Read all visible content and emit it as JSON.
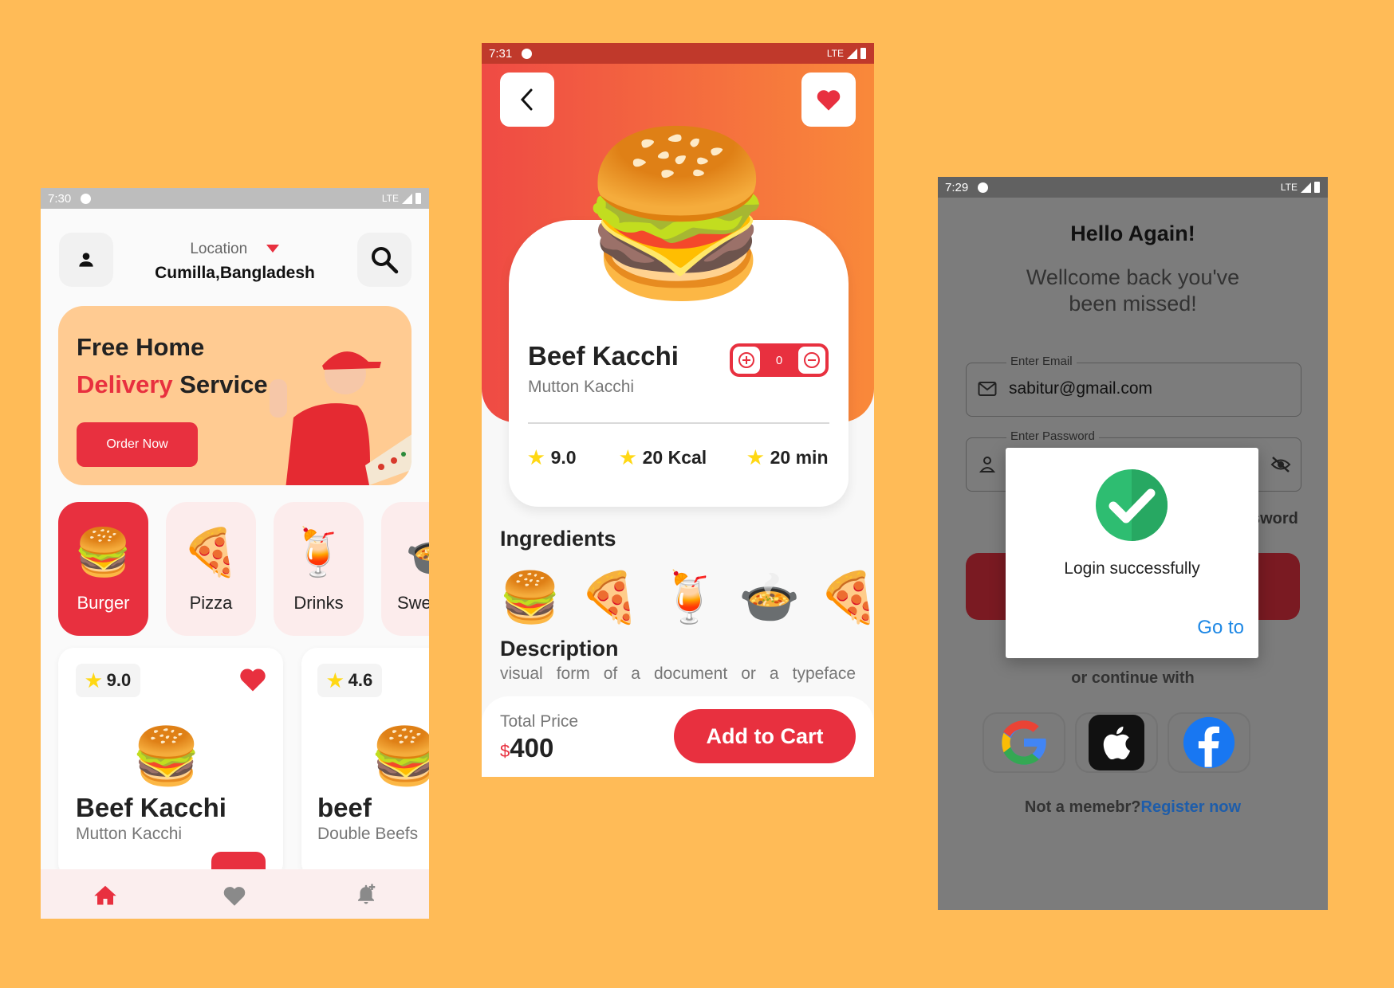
{
  "home": {
    "status": {
      "time": "7:30",
      "network": "LTE"
    },
    "location_label": "Location",
    "location_value": "Cumilla,Bangladesh",
    "banner": {
      "line1": "Free Home",
      "accent": "Delivery",
      "rest": " Service",
      "cta": "Order Now"
    },
    "categories": [
      {
        "label": "Burger",
        "icon": "burger-icon"
      },
      {
        "label": "Pizza",
        "icon": "pizza-icon"
      },
      {
        "label": "Drinks",
        "icon": "drinks-icon"
      },
      {
        "label": "Swe",
        "icon": "sweets-icon"
      }
    ],
    "cards": [
      {
        "rating": "9.0",
        "title": "Beef Kacchi",
        "subtitle": "Mutton Kacchi",
        "favorite": true
      },
      {
        "rating": "4.6",
        "title": "beef",
        "subtitle": "Double Beefs",
        "favorite": false
      }
    ],
    "nav": [
      "home-icon",
      "heart-icon",
      "notification-add-icon"
    ]
  },
  "detail": {
    "status": {
      "time": "7:31",
      "network": "LTE"
    },
    "title": "Beef Kacchi",
    "subtitle": "Mutton Kacchi",
    "quantity": "0",
    "stats": [
      {
        "value": "9.0"
      },
      {
        "value": "20 Kcal"
      },
      {
        "value": "20 min"
      }
    ],
    "ingredients_title": "Ingredients",
    "ingredients": [
      "burger-icon",
      "pizza-icon",
      "drinks-icon",
      "sweets-icon",
      "pizza-icon"
    ],
    "description_title": "Description",
    "description_text": "visual form of a document or a typeface",
    "total_label": "Total Price",
    "currency": "$",
    "price": "400",
    "cta": "Add to Cart"
  },
  "login": {
    "status": {
      "time": "7:29",
      "network": "LTE"
    },
    "heading": "Hello Again!",
    "subheading_line1": "Wellcome back you've",
    "subheading_line2": "been missed!",
    "email_label": "Enter Email",
    "email_value": "sabitur@gmail.com",
    "password_label": "Enter Password",
    "forgot_partial": "sword",
    "continue_with": "or continue with",
    "socials": [
      "google-icon",
      "apple-icon",
      "facebook-icon"
    ],
    "not_member": "Not a memebr?",
    "register": "Register now",
    "dialog": {
      "message": "Login successfully",
      "action": "Go to"
    }
  },
  "colors": {
    "background": "#FFBB57",
    "primary": "#E8303F",
    "banner": "#FFCB92",
    "link": "#1E88E5",
    "success": "#2EBD71"
  }
}
